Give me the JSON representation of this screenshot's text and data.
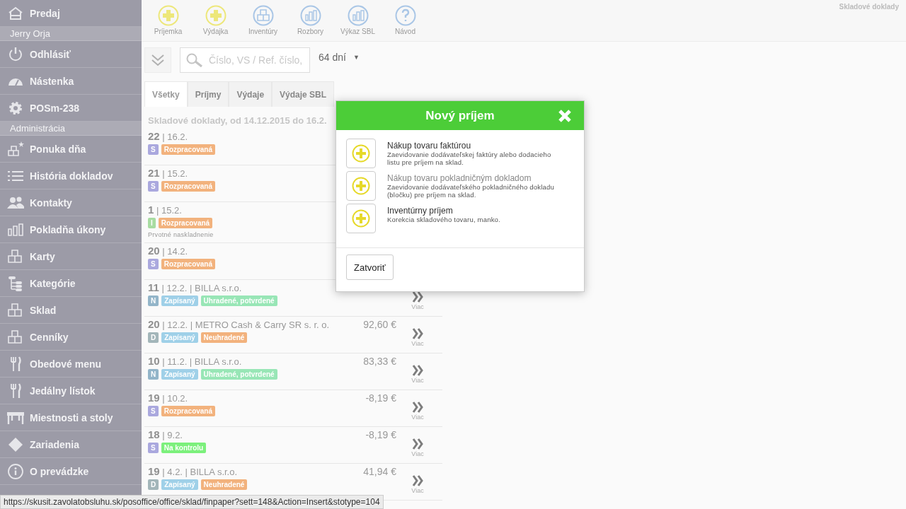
{
  "sidebar": {
    "items": [
      {
        "kind": "item",
        "label": "Predaj"
      },
      {
        "kind": "header",
        "label": "Jerry Orja"
      },
      {
        "kind": "item",
        "label": "Odhlásiť"
      },
      {
        "kind": "item",
        "label": "Nástenka"
      },
      {
        "kind": "item",
        "label": "POSm-238"
      },
      {
        "kind": "header",
        "label": "Administrácia"
      },
      {
        "kind": "item",
        "label": "Ponuka dňa"
      },
      {
        "kind": "item",
        "label": "História dokladov"
      },
      {
        "kind": "item",
        "label": "Kontakty"
      },
      {
        "kind": "item",
        "label": "Pokladňa úkony"
      },
      {
        "kind": "item",
        "label": "Karty"
      },
      {
        "kind": "item",
        "label": "Kategórie"
      },
      {
        "kind": "item",
        "label": "Sklad"
      },
      {
        "kind": "item",
        "label": "Cenníky"
      },
      {
        "kind": "item",
        "label": "Obedové menu"
      },
      {
        "kind": "item",
        "label": "Jedálny lístok"
      },
      {
        "kind": "item",
        "label": "Miestnosti a stoly"
      },
      {
        "kind": "item",
        "label": "Zariadenia"
      },
      {
        "kind": "item",
        "label": "O prevádzke"
      }
    ]
  },
  "toolbar": [
    {
      "label": "Príjemka",
      "color": "#ede77a"
    },
    {
      "label": "Výdajka",
      "color": "#ede77a"
    },
    {
      "label": "Inventúry",
      "color": "#a9c6e6"
    },
    {
      "label": "Rozbory",
      "color": "#a9c6e6"
    },
    {
      "label": "Výkaz SBL",
      "color": "#a9c6e6"
    },
    {
      "label": "Návod",
      "color": "#a9c6e6"
    }
  ],
  "page_title": "Skladové doklady",
  "search": {
    "placeholder": "Číslo, VS / Ref. číslo,",
    "period": "64 dní",
    "caret": "▼"
  },
  "tabs": [
    {
      "label": "Všetky",
      "selected": true
    },
    {
      "label": "Príjmy",
      "selected": false
    },
    {
      "label": "Výdaje",
      "selected": false
    },
    {
      "label": "Výdaje SBL",
      "selected": false
    }
  ],
  "list_heading": "Skladové doklady, od 14.12.2015 do 16.2.",
  "documents": [
    {
      "title": "**22** | 16.2.",
      "tags": [
        {
          "text": "S",
          "color": "#aaa8de"
        },
        {
          "text": "Rozpracovaná",
          "color": "#f2b27d"
        }
      ]
    },
    {
      "title": "**21** | 15.2.",
      "tags": [
        {
          "text": "S",
          "color": "#aaa8de"
        },
        {
          "text": "Rozpracovaná",
          "color": "#f2b27d"
        }
      ]
    },
    {
      "title": "**1** | 15.2.",
      "note": "Prvotné naskladnenie",
      "tags": [
        {
          "text": "I",
          "color": "#a8dca2"
        },
        {
          "text": "Rozpracovaná",
          "color": "#f2b27d"
        }
      ]
    },
    {
      "title": "**20** | 14.2.",
      "tags": [
        {
          "text": "S",
          "color": "#aaa8de"
        },
        {
          "text": "Rozpracovaná",
          "color": "#f2b27d"
        }
      ]
    },
    {
      "title": "**11** | 12.2. | BILLA s.r.o.",
      "more": "Viac",
      "tags": [
        {
          "text": "N",
          "color": "#93b5c9"
        },
        {
          "text": "Zapísaný",
          "color": "#9fd0e8"
        },
        {
          "text": "Uhradené, potvrdené",
          "color": "#98e6b6"
        }
      ]
    },
    {
      "title": "**20** | 12.2. | METRO Cash & Carry SR s. r. o.",
      "amount": "92,60 €",
      "more": "Viac",
      "tags": [
        {
          "text": "D",
          "color": "#a3b6ba"
        },
        {
          "text": "Zapísaný",
          "color": "#9fd0e8"
        },
        {
          "text": "Neuhradené",
          "color": "#f2b27d"
        }
      ]
    },
    {
      "title": "**10** | 11.2. | BILLA s.r.o.",
      "amount": "83,33 €",
      "more": "Viac",
      "tags": [
        {
          "text": "N",
          "color": "#93b5c9"
        },
        {
          "text": "Zapísaný",
          "color": "#9fd0e8"
        },
        {
          "text": "Uhradené, potvrdené",
          "color": "#98e6b6"
        }
      ]
    },
    {
      "title": "**19** | 10.2.",
      "amount": "-8,19 €",
      "more": "Viac",
      "tags": [
        {
          "text": "S",
          "color": "#aaa8de"
        },
        {
          "text": "Rozpracovaná",
          "color": "#f2b27d"
        }
      ]
    },
    {
      "title": "**18** | 9.2.",
      "amount": "-8,19 €",
      "more": "Viac",
      "tags": [
        {
          "text": "S",
          "color": "#aaa8de"
        },
        {
          "text": "Na kontrolu",
          "color": "#7cf07c"
        }
      ]
    },
    {
      "title": "**19** | 4.2. | BILLA s.r.o.",
      "amount": "41,94 €",
      "more": "Viac",
      "tags": [
        {
          "text": "D",
          "color": "#a3b6ba"
        },
        {
          "text": "Zapísaný",
          "color": "#9fd0e8"
        },
        {
          "text": "Neuhradené",
          "color": "#f2b27d"
        }
      ]
    }
  ],
  "dialog": {
    "title": "Nový príjem",
    "options": [
      {
        "title": "Nákup tovaru faktúrou",
        "description": "Zaevidovanie dodávateľskej faktúry alebo dodacieho listu pre príjem na sklad.",
        "hovered": false
      },
      {
        "title": "Nákup tovaru pokladničným dokladom",
        "description": "Zaevidovanie dodávateľského pokladničného dokladu (bločku) pre príjem na sklad.",
        "hovered": true
      },
      {
        "title": "Inventúrny príjem",
        "description": "Korekcia skladového tovaru, manko.",
        "hovered": false
      }
    ],
    "close_button": "Zatvoriť"
  },
  "status_bar": "https://skusit.zavolatobsluhu.sk/posoffice/office/sklad/finpaper?sett=148&Action=Insert&stotype=104"
}
